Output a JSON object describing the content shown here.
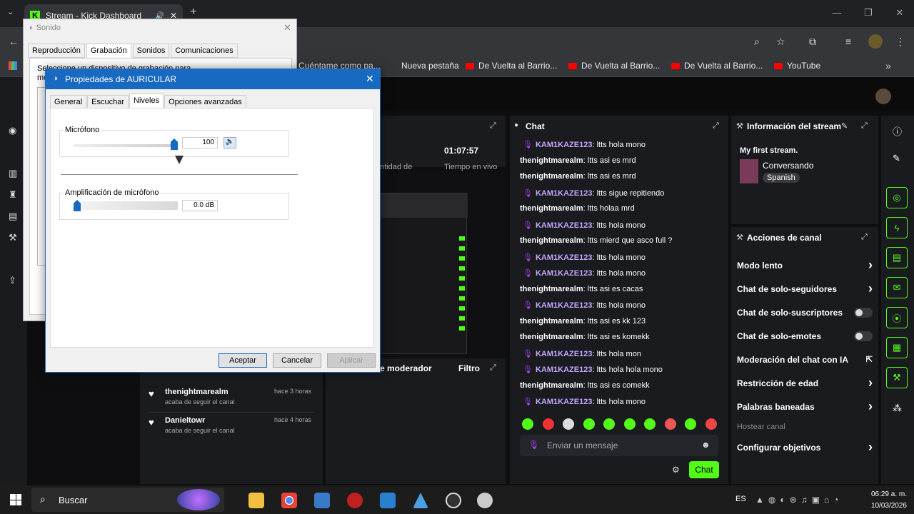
{
  "browser": {
    "tab_title": "Stream - Kick Dashboard",
    "bookmarks": [
      {
        "label": "Cuéntame como pa..."
      },
      {
        "label": "Nueva pestaña"
      },
      {
        "label": "De Vuelta al Barrio..."
      },
      {
        "label": "De Vuelta al Barrio..."
      },
      {
        "label": "De Vuelta al Barrio..."
      },
      {
        "label": "YouTube"
      }
    ]
  },
  "dashboard": {
    "stats": {
      "duration": "01:07:57",
      "duration_label": "Tiempo en vivo",
      "viewers_label": "ntidad de"
    },
    "moderator_panel": {
      "title": "e moderador",
      "filter_label": "Filtro"
    },
    "followers": [
      {
        "name": "thenightmarealm",
        "action": "acaba de seguir el canal",
        "time": "hace 3 horas"
      },
      {
        "name": "Danieltowr",
        "action": "acaba de seguir el canal",
        "time": "hace 4 horas"
      }
    ],
    "chat": {
      "title": "Chat",
      "placeholder": "Enviar un mensaje",
      "send_label": "Chat",
      "messages": [
        {
          "user": "KAM1KAZE123",
          "text": "ltts hola mono",
          "mic": true
        },
        {
          "user": "thenightmarealm",
          "text": "ltts asi es mrd",
          "mic": false
        },
        {
          "user": "thenightmarealm",
          "text": "ltts asi es mrd",
          "mic": false
        },
        {
          "user": "KAM1KAZE123",
          "text": "ltts sigue repitiendo",
          "mic": true
        },
        {
          "user": "thenightmarealm",
          "text": "ltts holaa mrd",
          "mic": false
        },
        {
          "user": "KAM1KAZE123",
          "text": "ltts hola mono",
          "mic": true
        },
        {
          "user": "thenightmarealm",
          "text": "ltts mierd que asco full ?",
          "mic": false
        },
        {
          "user": "KAM1KAZE123",
          "text": "ltts hola mono",
          "mic": true
        },
        {
          "user": "KAM1KAZE123",
          "text": "ltts hola mono",
          "mic": true
        },
        {
          "user": "thenightmarealm",
          "text": "ltts asi es cacas",
          "mic": false
        },
        {
          "user": "KAM1KAZE123",
          "text": "ltts hola mono",
          "mic": true
        },
        {
          "user": "thenightmarealm",
          "text": "ltts asi es kk 123",
          "mic": false
        },
        {
          "user": "thenightmarealm",
          "text": "ltts asi es komekk",
          "mic": false
        },
        {
          "user": "KAM1KAZE123",
          "text": "ltts hola mon",
          "mic": true
        },
        {
          "user": "KAM1KAZE123",
          "text": "ltts hola hola mono",
          "mic": true
        },
        {
          "user": "thenightmarealm",
          "text": "ltts asi es comekk",
          "mic": false
        },
        {
          "user": "KAM1KAZE123",
          "text": "ltts hola mono",
          "mic": true
        }
      ]
    },
    "stream_info": {
      "title": "Información del stream",
      "stream_title": "My first stream.",
      "category": "Conversando",
      "language": "Spanish"
    },
    "channel_actions": {
      "title": "Acciones de canal",
      "items": [
        {
          "label": "Modo lento",
          "control": "chevron"
        },
        {
          "label": "Chat de solo-seguidores",
          "control": "chevron"
        },
        {
          "label": "Chat de solo-suscriptores",
          "control": "toggle"
        },
        {
          "label": "Chat de solo-emotes",
          "control": "toggle"
        },
        {
          "label": "Moderación del chat con IA",
          "control": "external"
        },
        {
          "label": "Restricción de edad",
          "control": "chevron"
        },
        {
          "label": "Palabras baneadas",
          "control": "chevron"
        },
        {
          "label": "Hostear canal",
          "control": "none"
        },
        {
          "label": "Configurar objetivos",
          "control": "chevron"
        }
      ]
    }
  },
  "sound_dialog": {
    "title": "Sonido",
    "tabs": [
      "Reproducción",
      "Grabación",
      "Sonidos",
      "Comunicaciones"
    ],
    "text": "Seleccione un dispositivo de grabación para modificar su co"
  },
  "props_dialog": {
    "title": "Propiedades de AURICULAR",
    "tabs": [
      "General",
      "Escuchar",
      "Niveles",
      "Opciones avanzadas"
    ],
    "active_tab": "Niveles",
    "mic_label": "Micrófono",
    "mic_value": "100",
    "mic_level": 1.0,
    "boost_label": "Amplificación de micrófono",
    "boost_value": "0.0 dB",
    "boost_level": 0.0,
    "buttons": {
      "ok": "Aceptar",
      "cancel": "Cancelar",
      "apply": "Aplicar"
    }
  },
  "taskbar": {
    "search": "Buscar",
    "lang": "ES",
    "time": "06:29 a. m.",
    "date": "10/03/2026"
  }
}
